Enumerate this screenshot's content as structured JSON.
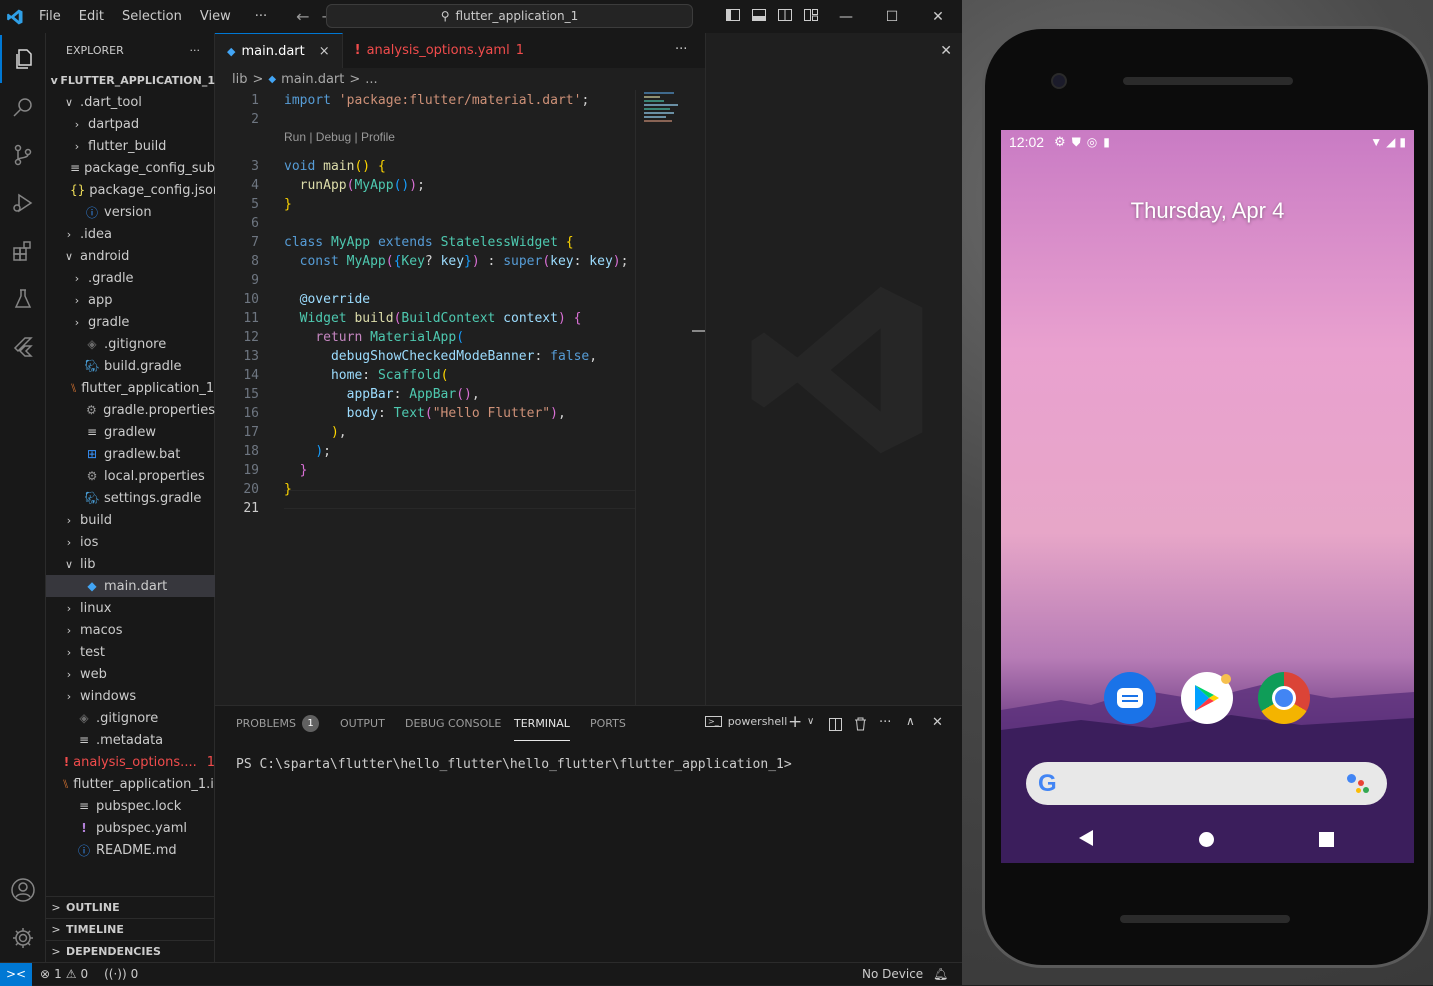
{
  "titlebar": {
    "menus": [
      "File",
      "Edit",
      "Selection",
      "View"
    ],
    "more": "···",
    "search": "flutter_application_1"
  },
  "explorer": {
    "header": "EXPLORER",
    "more": "···",
    "root": "FLUTTER_APPLICATION_1",
    "items": [
      {
        "label": ".dart_tool",
        "depth": 1,
        "chev": "v",
        "icon": "folder",
        "color": "#cccccc"
      },
      {
        "label": "dartpad",
        "depth": 2,
        "chev": ">",
        "icon": "folder",
        "color": "#cccccc"
      },
      {
        "label": "flutter_build",
        "depth": 2,
        "chev": ">",
        "icon": "folder",
        "color": "#cccccc"
      },
      {
        "label": "package_config_sub...",
        "depth": 2,
        "chev": "",
        "icon": "lines-icon",
        "color": "#cccccc"
      },
      {
        "label": "package_config.json",
        "depth": 2,
        "chev": "",
        "icon": "json-icon",
        "color": "#cccccc"
      },
      {
        "label": "version",
        "depth": 2,
        "chev": "",
        "icon": "info-icon",
        "color": "#cccccc"
      },
      {
        "label": ".idea",
        "depth": 1,
        "chev": ">",
        "icon": "folder",
        "color": "#cccccc"
      },
      {
        "label": "android",
        "depth": 1,
        "chev": "v",
        "icon": "folder",
        "color": "#cccccc"
      },
      {
        "label": ".gradle",
        "depth": 2,
        "chev": ">",
        "icon": "folder",
        "color": "#cccccc"
      },
      {
        "label": "app",
        "depth": 2,
        "chev": ">",
        "icon": "folder",
        "color": "#cccccc"
      },
      {
        "label": "gradle",
        "depth": 2,
        "chev": ">",
        "icon": "folder",
        "color": "#cccccc"
      },
      {
        "label": ".gitignore",
        "depth": 2,
        "chev": "",
        "icon": "git-icon",
        "color": "#cccccc"
      },
      {
        "label": "build.gradle",
        "depth": 2,
        "chev": "",
        "icon": "elephant-icon",
        "color": "#cccccc"
      },
      {
        "label": "flutter_application_1...",
        "depth": 2,
        "chev": "",
        "icon": "rss-icon",
        "color": "#cccccc"
      },
      {
        "label": "gradle.properties",
        "depth": 2,
        "chev": "",
        "icon": "gear-icon",
        "color": "#cccccc"
      },
      {
        "label": "gradlew",
        "depth": 2,
        "chev": "",
        "icon": "lines-icon",
        "color": "#cccccc"
      },
      {
        "label": "gradlew.bat",
        "depth": 2,
        "chev": "",
        "icon": "windows-icon",
        "color": "#cccccc"
      },
      {
        "label": "local.properties",
        "depth": 2,
        "chev": "",
        "icon": "gear-icon",
        "color": "#cccccc"
      },
      {
        "label": "settings.gradle",
        "depth": 2,
        "chev": "",
        "icon": "elephant-icon",
        "color": "#cccccc"
      },
      {
        "label": "build",
        "depth": 1,
        "chev": ">",
        "icon": "folder",
        "color": "#cccccc"
      },
      {
        "label": "ios",
        "depth": 1,
        "chev": ">",
        "icon": "folder",
        "color": "#cccccc"
      },
      {
        "label": "lib",
        "depth": 1,
        "chev": "v",
        "icon": "folder",
        "color": "#cccccc"
      },
      {
        "label": "main.dart",
        "depth": 2,
        "chev": "",
        "icon": "dart-icon",
        "color": "#cccccc",
        "selected": true
      },
      {
        "label": "linux",
        "depth": 1,
        "chev": ">",
        "icon": "folder",
        "color": "#cccccc"
      },
      {
        "label": "macos",
        "depth": 1,
        "chev": ">",
        "icon": "folder",
        "color": "#cccccc"
      },
      {
        "label": "test",
        "depth": 1,
        "chev": ">",
        "icon": "folder",
        "color": "#cccccc"
      },
      {
        "label": "web",
        "depth": 1,
        "chev": ">",
        "icon": "folder",
        "color": "#cccccc"
      },
      {
        "label": "windows",
        "depth": 1,
        "chev": ">",
        "icon": "folder",
        "color": "#cccccc"
      },
      {
        "label": ".gitignore",
        "depth": 1,
        "chev": "",
        "icon": "git-icon",
        "color": "#cccccc"
      },
      {
        "label": ".metadata",
        "depth": 1,
        "chev": "",
        "icon": "lines-icon",
        "color": "#cccccc"
      },
      {
        "label": "analysis_options....",
        "depth": 1,
        "chev": "",
        "icon": "exclamation-icon",
        "color": "#f14c4c",
        "badge": "1"
      },
      {
        "label": "flutter_application_1.i...",
        "depth": 1,
        "chev": "",
        "icon": "rss-icon",
        "color": "#cccccc"
      },
      {
        "label": "pubspec.lock",
        "depth": 1,
        "chev": "",
        "icon": "lines-icon",
        "color": "#cccccc"
      },
      {
        "label": "pubspec.yaml",
        "depth": 1,
        "chev": "",
        "icon": "exclamation-icon",
        "color": "#cccccc"
      },
      {
        "label": "README.md",
        "depth": 1,
        "chev": "",
        "icon": "info-icon",
        "color": "#cccccc"
      }
    ],
    "sections": [
      "OUTLINE",
      "TIMELINE",
      "DEPENDENCIES"
    ]
  },
  "tabs": [
    {
      "label": "main.dart",
      "active": true,
      "close": "×"
    },
    {
      "label": "analysis_options.yaml",
      "badge": "1",
      "warn": true
    }
  ],
  "tabs_more": "···",
  "breadcrumb": [
    "lib",
    ">",
    "main.dart",
    ">",
    "..."
  ],
  "code_lens": "Run | Debug | Profile",
  "code_lines": [
    {
      "n": "1",
      "html": [
        [
          "kw",
          "import"
        ],
        [
          "pl",
          " "
        ],
        [
          "str",
          "'package:flutter/material.dart'"
        ],
        [
          "pl",
          ";"
        ]
      ]
    },
    {
      "n": "2",
      "html": []
    },
    {
      "n": "3",
      "html": [
        [
          "kw",
          "void"
        ],
        [
          "pl",
          " "
        ],
        [
          "fn",
          "main"
        ],
        [
          "br1",
          "()"
        ],
        [
          "pl",
          " "
        ],
        [
          "br1",
          "{"
        ]
      ]
    },
    {
      "n": "4",
      "html": [
        [
          "pl",
          "  "
        ],
        [
          "fn",
          "runApp"
        ],
        [
          "br2",
          "("
        ],
        [
          "cls",
          "MyApp"
        ],
        [
          "br3",
          "()"
        ],
        [
          "br2",
          ")"
        ],
        [
          "pl",
          ";"
        ]
      ]
    },
    {
      "n": "5",
      "html": [
        [
          "br1",
          "}"
        ]
      ]
    },
    {
      "n": "6",
      "html": []
    },
    {
      "n": "7",
      "html": [
        [
          "kw",
          "class"
        ],
        [
          "pl",
          " "
        ],
        [
          "cls",
          "MyApp"
        ],
        [
          "pl",
          " "
        ],
        [
          "kw",
          "extends"
        ],
        [
          "pl",
          " "
        ],
        [
          "cls",
          "StatelessWidget"
        ],
        [
          "pl",
          " "
        ],
        [
          "br1",
          "{"
        ]
      ]
    },
    {
      "n": "8",
      "html": [
        [
          "pl",
          "  "
        ],
        [
          "kw",
          "const"
        ],
        [
          "pl",
          " "
        ],
        [
          "cls",
          "MyApp"
        ],
        [
          "br2",
          "("
        ],
        [
          "br3",
          "{"
        ],
        [
          "cls",
          "Key"
        ],
        [
          "pl",
          "? "
        ],
        [
          "var",
          "key"
        ],
        [
          "br3",
          "}"
        ],
        [
          "br2",
          ")"
        ],
        [
          "pl",
          " : "
        ],
        [
          "kw",
          "super"
        ],
        [
          "br2",
          "("
        ],
        [
          "var",
          "key"
        ],
        [
          "pl",
          ": "
        ],
        [
          "var",
          "key"
        ],
        [
          "br2",
          ")"
        ],
        [
          "pl",
          ";"
        ]
      ]
    },
    {
      "n": "9",
      "html": []
    },
    {
      "n": "10",
      "html": [
        [
          "pl",
          "  "
        ],
        [
          "var",
          "@override"
        ]
      ]
    },
    {
      "n": "11",
      "html": [
        [
          "pl",
          "  "
        ],
        [
          "cls",
          "Widget"
        ],
        [
          "pl",
          " "
        ],
        [
          "fn",
          "build"
        ],
        [
          "br2",
          "("
        ],
        [
          "cls",
          "BuildContext"
        ],
        [
          "pl",
          " "
        ],
        [
          "var",
          "context"
        ],
        [
          "br2",
          ")"
        ],
        [
          "pl",
          " "
        ],
        [
          "br2",
          "{"
        ]
      ]
    },
    {
      "n": "12",
      "html": [
        [
          "pl",
          "    "
        ],
        [
          "ctl",
          "return"
        ],
        [
          "pl",
          " "
        ],
        [
          "cls",
          "MaterialApp"
        ],
        [
          "br3",
          "("
        ]
      ]
    },
    {
      "n": "13",
      "html": [
        [
          "pl",
          "      "
        ],
        [
          "var",
          "debugShowCheckedModeBanner"
        ],
        [
          "pl",
          ": "
        ],
        [
          "kw",
          "false"
        ],
        [
          "pl",
          ","
        ]
      ]
    },
    {
      "n": "14",
      "html": [
        [
          "pl",
          "      "
        ],
        [
          "var",
          "home"
        ],
        [
          "pl",
          ": "
        ],
        [
          "cls",
          "Scaffold"
        ],
        [
          "br1",
          "("
        ]
      ]
    },
    {
      "n": "15",
      "html": [
        [
          "pl",
          "        "
        ],
        [
          "var",
          "appBar"
        ],
        [
          "pl",
          ": "
        ],
        [
          "cls",
          "AppBar"
        ],
        [
          "br2",
          "()"
        ],
        [
          "pl",
          ","
        ]
      ]
    },
    {
      "n": "16",
      "html": [
        [
          "pl",
          "        "
        ],
        [
          "var",
          "body"
        ],
        [
          "pl",
          ": "
        ],
        [
          "cls",
          "Text"
        ],
        [
          "br2",
          "("
        ],
        [
          "str",
          "\"Hello Flutter\""
        ],
        [
          "br2",
          ")"
        ],
        [
          "pl",
          ","
        ]
      ]
    },
    {
      "n": "17",
      "html": [
        [
          "pl",
          "      "
        ],
        [
          "br1",
          ")"
        ],
        [
          "pl",
          ","
        ]
      ]
    },
    {
      "n": "18",
      "html": [
        [
          "pl",
          "    "
        ],
        [
          "br3",
          ")"
        ],
        [
          "pl",
          ";"
        ]
      ]
    },
    {
      "n": "19",
      "html": [
        [
          "pl",
          "  "
        ],
        [
          "br2",
          "}"
        ]
      ]
    },
    {
      "n": "20",
      "html": [
        [
          "br1",
          "}"
        ]
      ]
    },
    {
      "n": "21",
      "html": []
    }
  ],
  "panel": {
    "tabs": [
      "PROBLEMS",
      "OUTPUT",
      "DEBUG CONSOLE",
      "TERMINAL",
      "PORTS"
    ],
    "problems_badge": "1",
    "shell": "powershell",
    "more": "···",
    "terminal_line": "PS C:\\sparta\\flutter\\hello_flutter\\hello_flutter\\flutter_application_1>"
  },
  "status": {
    "errors": "1",
    "warnings": "0",
    "ports": "0",
    "device": "No Device"
  },
  "phone": {
    "time": "12:02",
    "date": "Thursday, Apr 4"
  },
  "colors": {
    "accent": "#0078d4",
    "error": "#f14c4c"
  }
}
